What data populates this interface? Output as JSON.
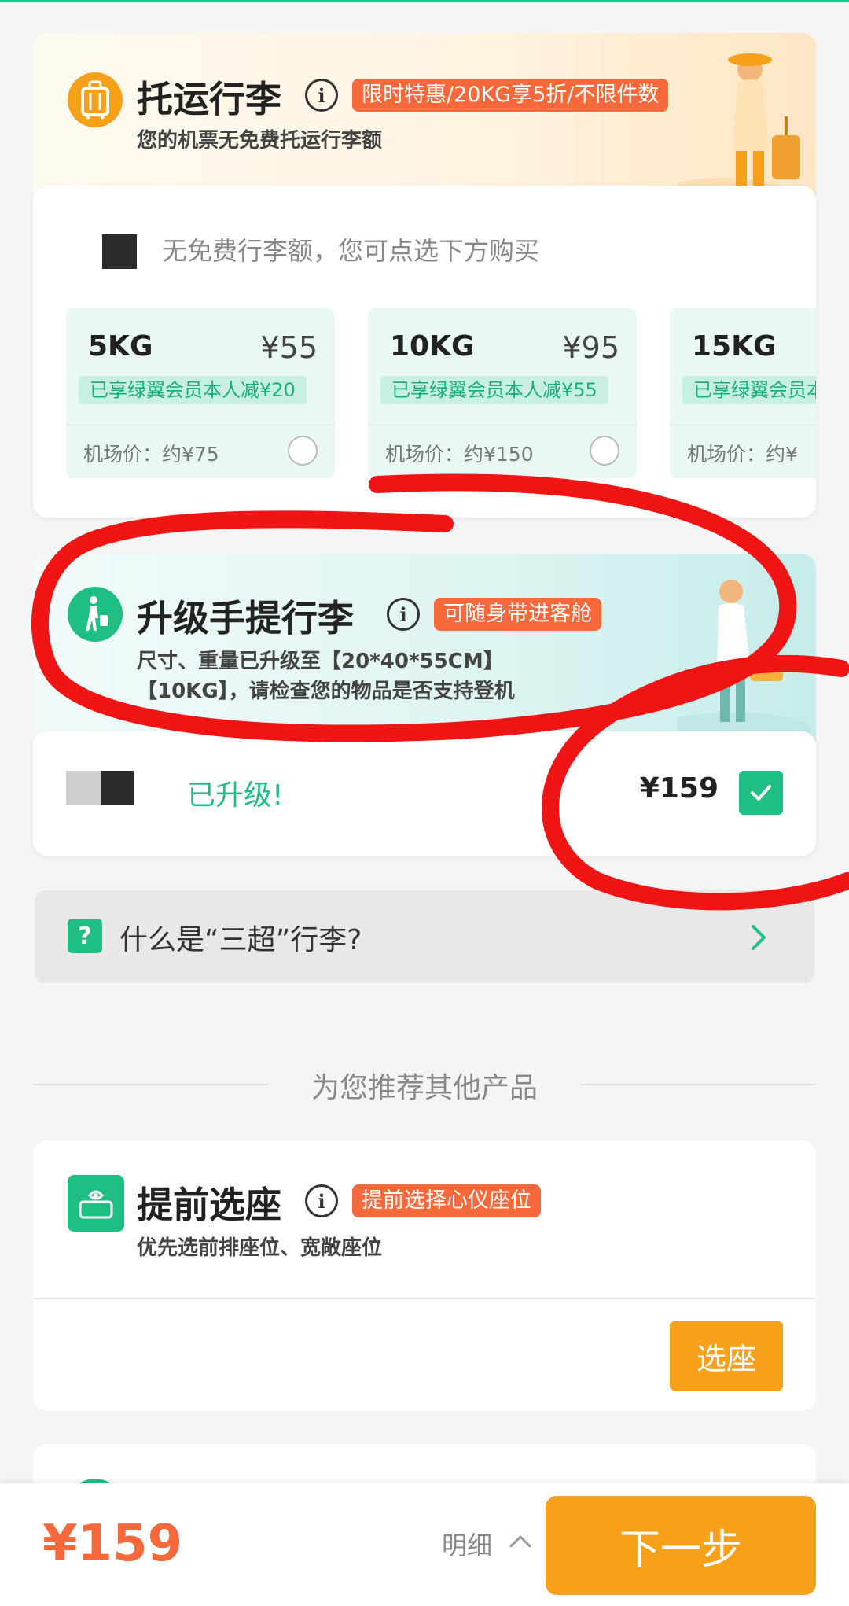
{
  "checked_baggage": {
    "title": "托运行李",
    "promo": "限时特惠/20KG享5折/不限件数",
    "subtitle": "您的机票无免费托运行李额",
    "notice": "无免费行李额，您可点选下方购买",
    "options": [
      {
        "weight": "5KG",
        "price": "¥55",
        "discount": "已享绿翼会员本人减¥20",
        "airport_price": "机场价：约¥75"
      },
      {
        "weight": "10KG",
        "price": "¥95",
        "discount": "已享绿翼会员本人减¥55",
        "airport_price": "机场价：约¥150"
      },
      {
        "weight": "15KG",
        "price": "",
        "discount": "已享绿翼会员本人",
        "airport_price": "机场价：约¥"
      }
    ]
  },
  "carry_on": {
    "title": "升级手提行李",
    "promo": "可随身带进客舱",
    "subtitle_line1": "尺寸、重量已升级至【20*40*55CM】",
    "subtitle_line2": "【10KG】，请检查您的物品是否支持登机",
    "status": "已升级!",
    "price": "¥159",
    "checked": true
  },
  "faq": {
    "label": "什么是“三超”行李?"
  },
  "recommend": {
    "label": "为您推荐其他产品"
  },
  "seat": {
    "title": "提前选座",
    "promo": "提前选择心仪座位",
    "subtitle": "优先选前排座位、宽敞座位",
    "button": "选座"
  },
  "bottom_bar": {
    "total": "¥159",
    "detail": "明细",
    "next": "下一步"
  },
  "colors": {
    "accent_green": "#1fbf84",
    "accent_orange": "#f7a11a",
    "promo_red": "#f7683a",
    "annotation_red": "#f01414"
  }
}
